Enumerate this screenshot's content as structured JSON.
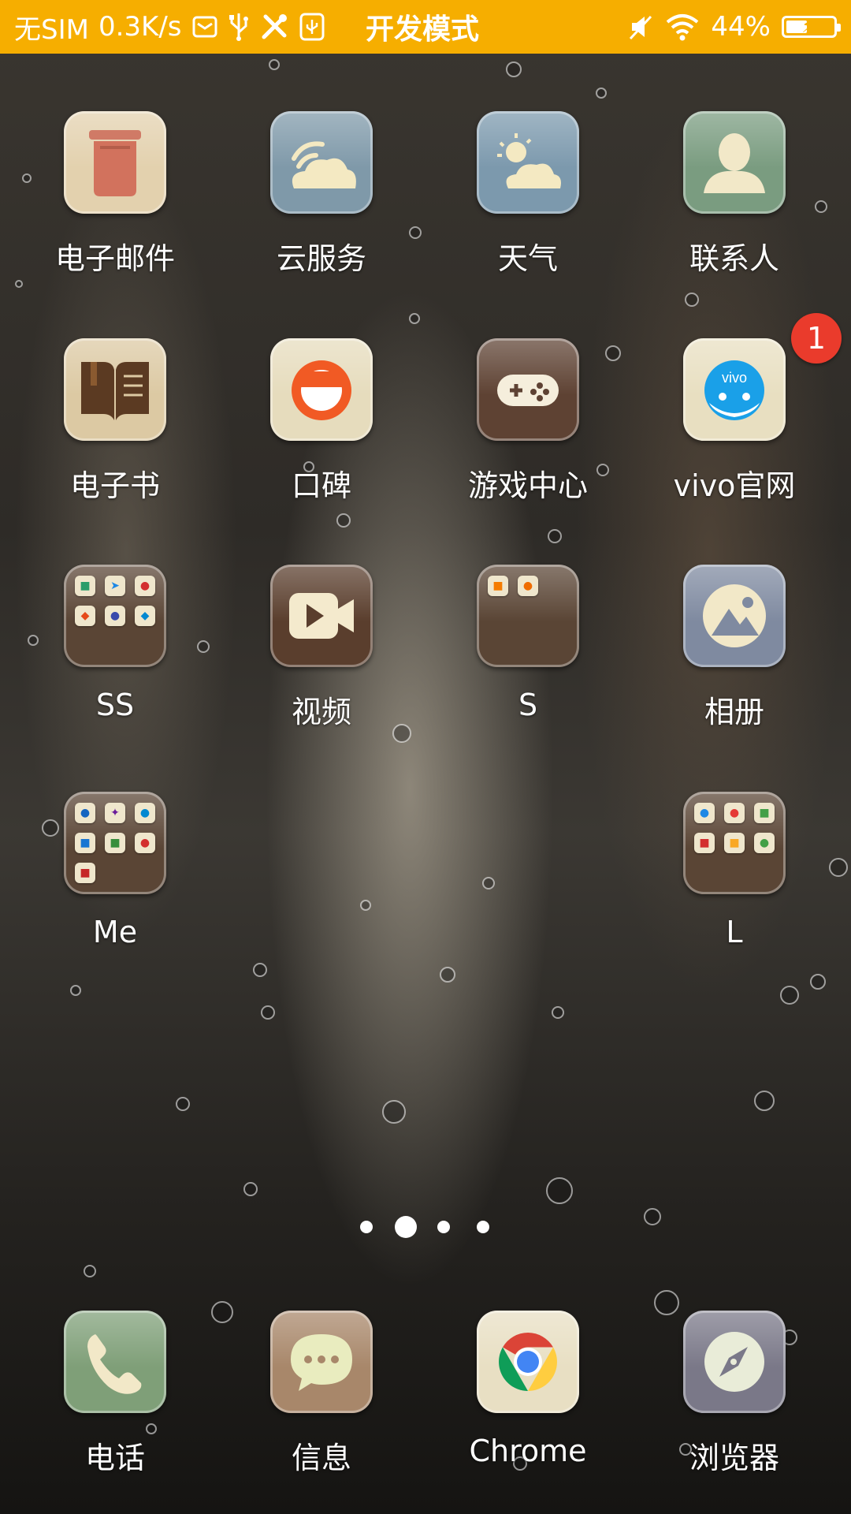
{
  "status_bar": {
    "sim": "无SIM",
    "speed": "0.3K/s",
    "mode": "开发模式",
    "battery": "44%",
    "battery_level": 0.44
  },
  "apps": {
    "email": {
      "label": "电子邮件"
    },
    "cloud": {
      "label": "云服务"
    },
    "weather": {
      "label": "天气"
    },
    "contacts": {
      "label": "联系人"
    },
    "ebook": {
      "label": "电子书"
    },
    "koubei": {
      "label": "口碑"
    },
    "game_center": {
      "label": "游戏中心"
    },
    "vivo_site": {
      "label": "vivo官网",
      "badge": "1",
      "logo_text": "vivo"
    },
    "folder_ss": {
      "label": "SS"
    },
    "video": {
      "label": "视频"
    },
    "folder_s": {
      "label": "S"
    },
    "gallery": {
      "label": "相册"
    },
    "folder_me": {
      "label": "Me"
    },
    "folder_l": {
      "label": "L"
    }
  },
  "page_indicator": {
    "pages": 4,
    "current": 2
  },
  "dock": {
    "phone": {
      "label": "电话"
    },
    "messages": {
      "label": "信息"
    },
    "chrome": {
      "label": "Chrome"
    },
    "browser": {
      "label": "浏览器"
    }
  }
}
